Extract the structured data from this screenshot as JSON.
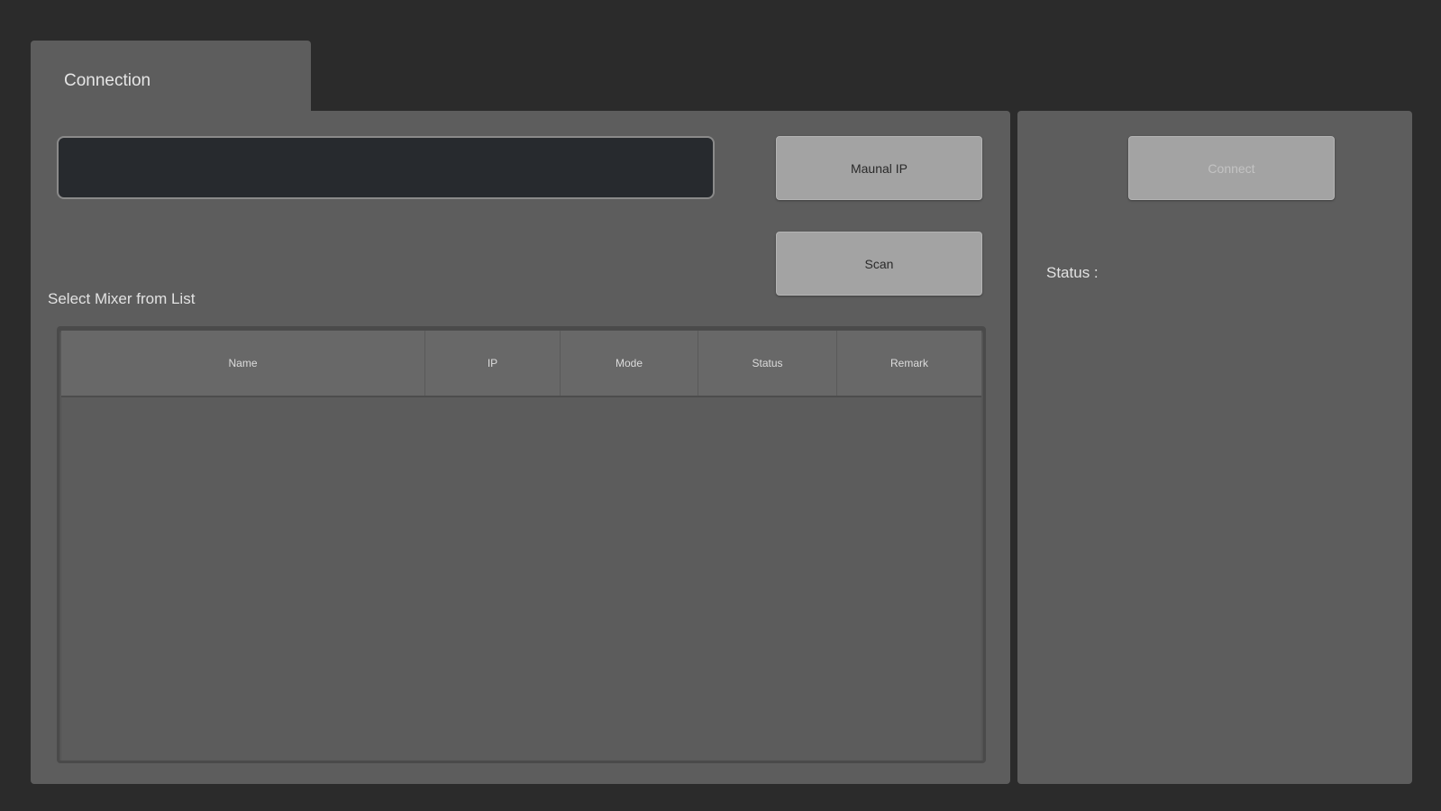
{
  "tab": {
    "label": "Connection"
  },
  "connection": {
    "ip_input_value": "",
    "manual_ip_label": "Maunal IP",
    "scan_label": "Scan",
    "list_label": "Select Mixer from List",
    "table": {
      "columns": [
        "Name",
        "IP",
        "Mode",
        "Status",
        "Remark"
      ],
      "rows": []
    }
  },
  "side": {
    "connect_label": "Connect",
    "status_label": "Status :"
  }
}
